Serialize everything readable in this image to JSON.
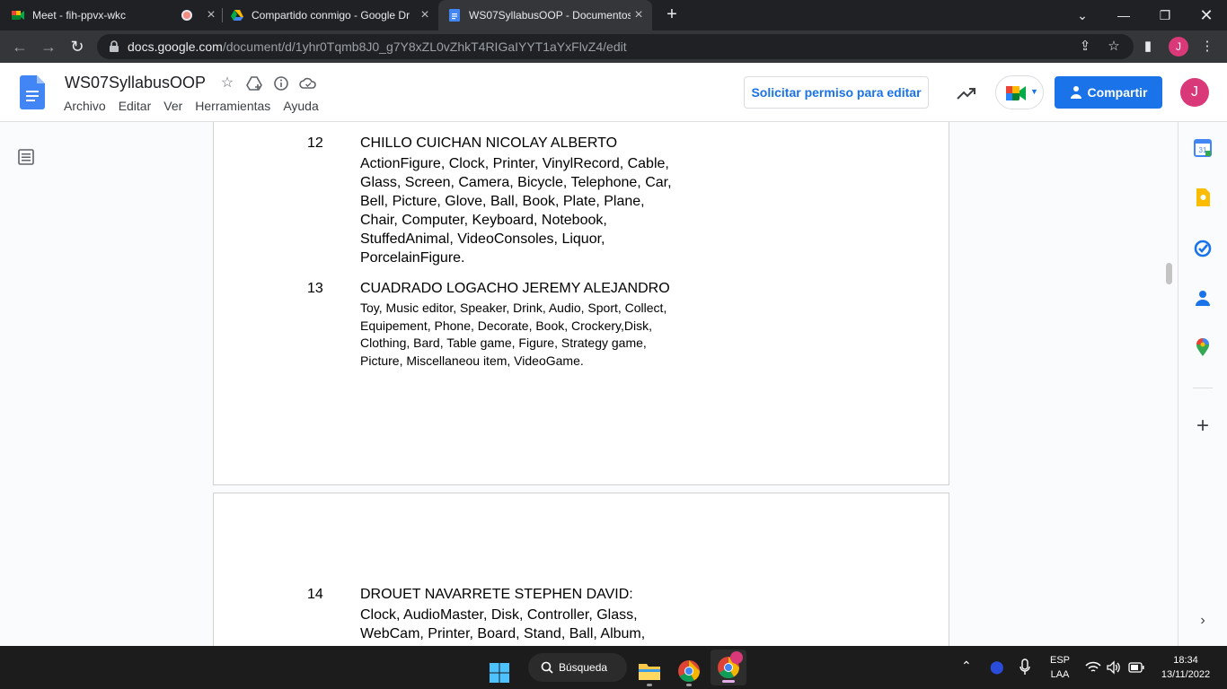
{
  "browser": {
    "tabs": [
      {
        "title": "Meet - fih-ppvx-wkc",
        "recording": true
      },
      {
        "title": "Compartido conmigo - Google Dr"
      },
      {
        "title": "WS07SyllabusOOP - Documentos"
      }
    ],
    "url_host": "docs.google.com",
    "url_path": "/document/d/1yhr0Tqmb8J0_g7Y8xZL0vZhkT4RIGaIYYT1aYxFlvZ4/edit",
    "profile_initial": "J"
  },
  "docs": {
    "title": "WS07SyllabusOOP",
    "menu": [
      "Archivo",
      "Editar",
      "Ver",
      "Herramientas",
      "Ayuda"
    ],
    "request_edit_label": "Solicitar permiso para editar",
    "share_label": "Compartir",
    "account_initial": "J"
  },
  "document": {
    "entries": [
      {
        "number": "12",
        "name": "CHILLO CUICHAN NICOLAY ALBERTO",
        "items": "ActionFigure, Clock, Printer, VinylRecord, Cable, Glass, Screen, Camera, Bicycle, Telephone, Car, Bell, Picture, Glove, Ball, Book, Plate, Plane, Chair, Computer, Keyboard, Notebook, StuffedAnimal, VideoConsoles, Liquor, PorcelainFigure."
      },
      {
        "number": "13",
        "name": "CUADRADO LOGACHO JEREMY ALEJANDRO",
        "items": "Toy, Music editor, Speaker, Drink, Audio, Sport, Collect, Equipement, Phone, Decorate, Book, Crockery,Disk, Clothing, Bard, Table game, Figure, Strategy game, Picture, Miscellaneou item, VideoGame."
      },
      {
        "number": "14",
        "name": "DROUET NAVARRETE STEPHEN DAVID:",
        "items": "Clock, AudioMaster, Disk, Controller, Glass, WebCam, Printer, Board, Stand, Ball, Album, Bicycle, Telephone, Perfume, Plate, Toy"
      }
    ]
  },
  "taskbar": {
    "search_label": "Búsqueda",
    "lang_line1": "ESP",
    "lang_line2": "LAA",
    "time": "18:34",
    "date": "13/11/2022"
  }
}
